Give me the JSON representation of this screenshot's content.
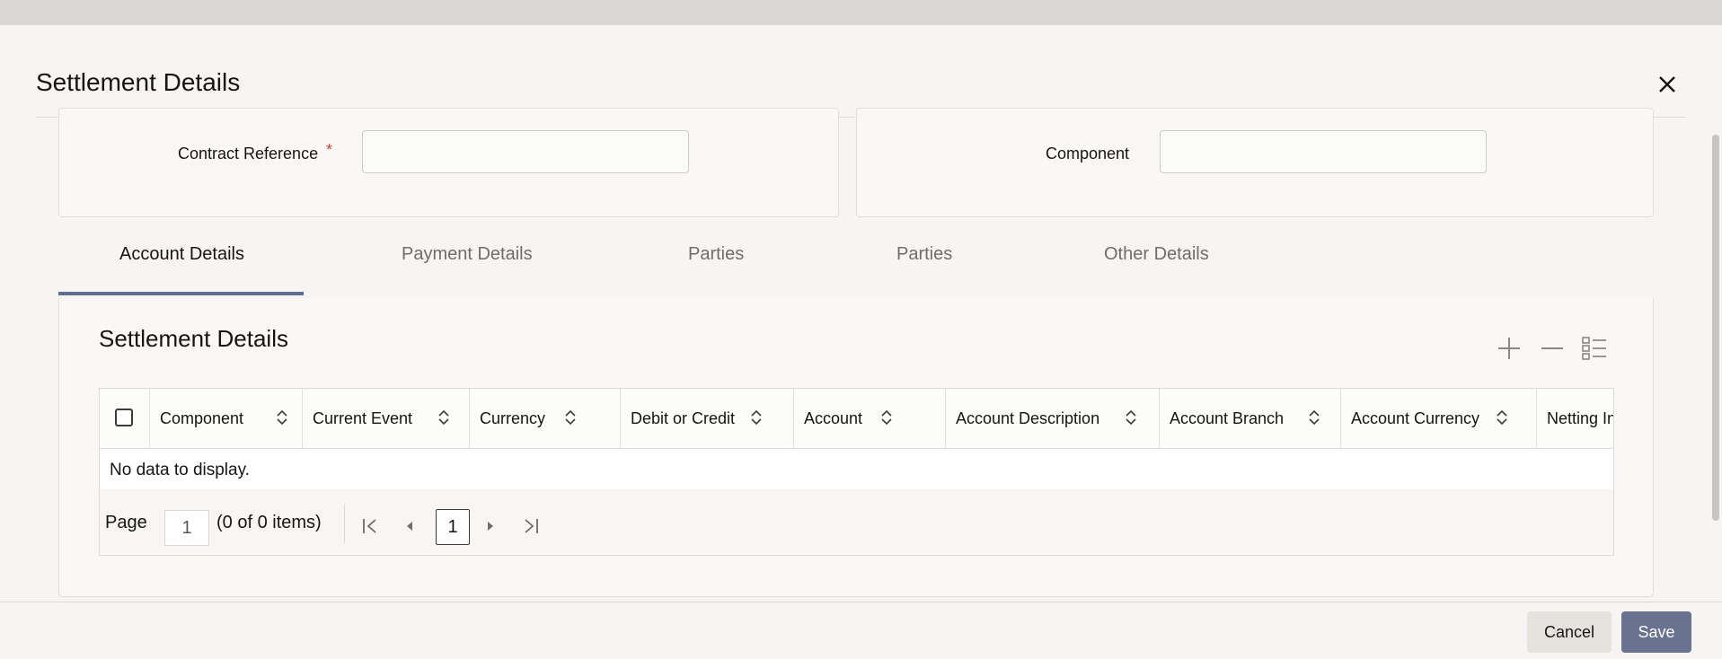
{
  "dialog": {
    "title": "Settlement Details"
  },
  "fields": {
    "contract_reference": {
      "label": "Contract Reference",
      "required_mark": "*",
      "value": ""
    },
    "component": {
      "label": "Component",
      "value": ""
    }
  },
  "tabs": [
    {
      "label": "Account Details",
      "active": true
    },
    {
      "label": "Payment Details",
      "active": false
    },
    {
      "label": "Parties",
      "active": false
    },
    {
      "label": "Parties",
      "active": false
    },
    {
      "label": "Other Details",
      "active": false
    }
  ],
  "section": {
    "title": "Settlement Details",
    "toolbar": {
      "add_icon": "plus-icon",
      "remove_icon": "minus-icon",
      "view_icon": "list-view-icon"
    }
  },
  "table": {
    "columns": [
      "Component",
      "Current Event",
      "Currency",
      "Debit or Credit",
      "Account",
      "Account Description",
      "Account Branch",
      "Account Currency",
      "Netting In"
    ],
    "rows": [],
    "empty_text": "No data to display."
  },
  "pagination": {
    "page_label": "Page",
    "page_value": "1",
    "count_text": "(0 of 0 items)",
    "current_page": "1"
  },
  "footer": {
    "cancel_label": "Cancel",
    "save_label": "Save"
  },
  "colors": {
    "accent": "#5d6f8e",
    "save_button": "#69728f",
    "required": "#c74634"
  }
}
